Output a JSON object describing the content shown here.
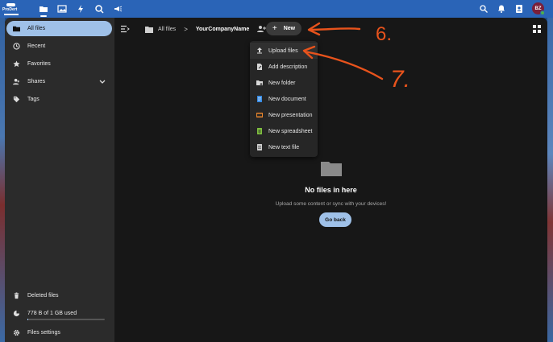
{
  "header": {
    "logo_text": "ProDert",
    "apps": [
      {
        "name": "files-app",
        "icon": "folder-icon"
      },
      {
        "name": "photos-app",
        "icon": "image-icon"
      },
      {
        "name": "activity-app",
        "icon": "lightning-icon"
      },
      {
        "name": "search-app",
        "icon": "search-icon"
      },
      {
        "name": "announcements-app",
        "icon": "megaphone-icon"
      }
    ],
    "avatar_initials": "BZ"
  },
  "sidebar": {
    "items": [
      {
        "label": "All files",
        "icon": "folder-icon"
      },
      {
        "label": "Recent",
        "icon": "history-icon"
      },
      {
        "label": "Favorites",
        "icon": "star-icon"
      },
      {
        "label": "Shares",
        "icon": "share-icon"
      },
      {
        "label": "Tags",
        "icon": "tag-icon"
      }
    ],
    "deleted_label": "Deleted files",
    "storage_label": "778 B of 1 GB used",
    "settings_label": "Files settings"
  },
  "breadcrumb": {
    "root": "All files",
    "separator": ">",
    "current": "YourCompanyName"
  },
  "new_button": {
    "plus": "+",
    "label": "New"
  },
  "new_menu": {
    "items": [
      {
        "label": "Upload files",
        "icon": "upload-icon",
        "color": "#d8d8d8"
      },
      {
        "label": "Add description",
        "icon": "file-edit-icon",
        "color": "#d8d8d8"
      },
      {
        "label": "New folder",
        "icon": "folder-plus-icon",
        "color": "#d8d8d8"
      },
      {
        "label": "New document",
        "icon": "document-icon",
        "color": "#3a8ee6"
      },
      {
        "label": "New presentation",
        "icon": "presentation-icon",
        "color": "#e8852c"
      },
      {
        "label": "New spreadsheet",
        "icon": "spreadsheet-icon",
        "color": "#7fbf3f"
      },
      {
        "label": "New text file",
        "icon": "text-file-icon",
        "color": "#cfcfcf"
      }
    ]
  },
  "empty_state": {
    "title": "No files in here",
    "subtitle": "Upload some content or sync with your devices!",
    "button": "Go back"
  },
  "annotations": {
    "label_6": "6.",
    "label_7": "7.",
    "color": "#e8531c"
  }
}
